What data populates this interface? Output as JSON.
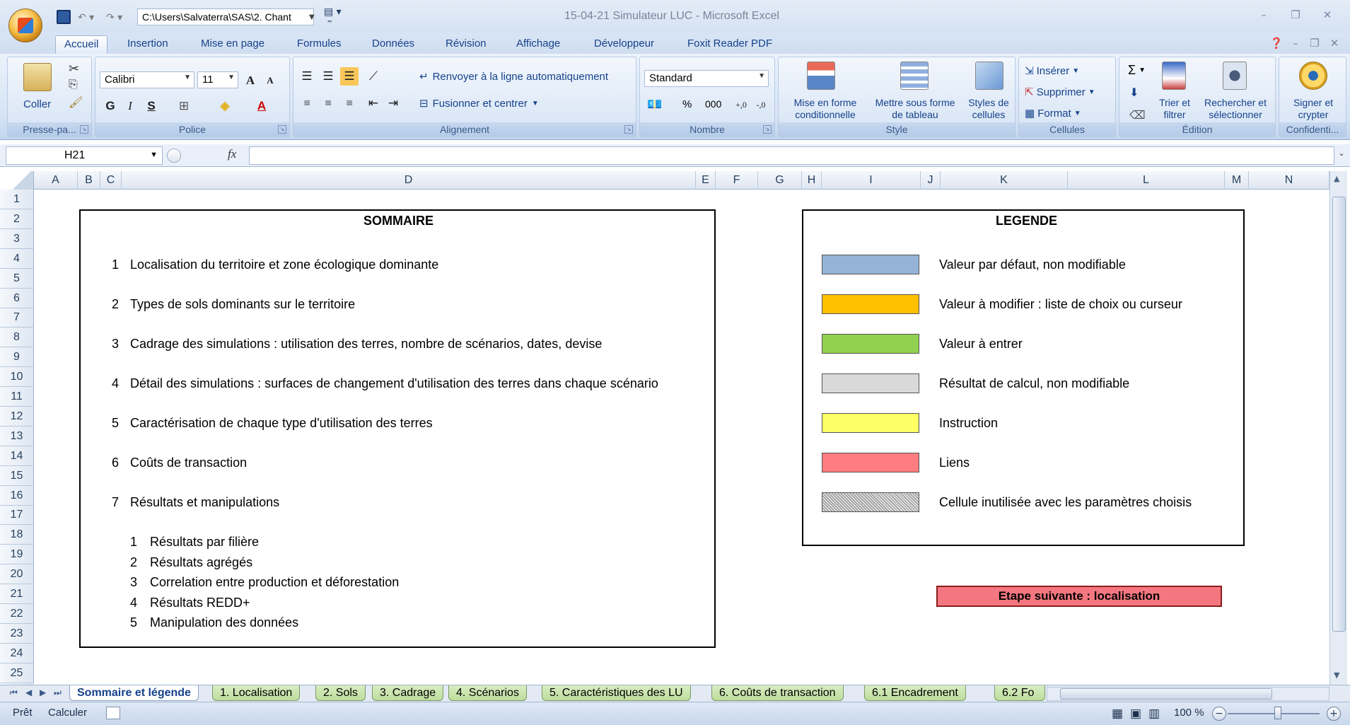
{
  "window": {
    "file_path": "C:\\Users\\Salvaterra\\SAS\\2. Chant",
    "title": "15-04-21 Simulateur LUC - Microsoft Excel"
  },
  "ribbon": {
    "tabs": [
      "Accueil",
      "Insertion",
      "Mise en page",
      "Formules",
      "Données",
      "Révision",
      "Affichage",
      "Développeur",
      "Foxit Reader PDF"
    ],
    "active_tab": "Accueil",
    "groups": {
      "clipboard": {
        "label": "Presse-pa...",
        "paste": "Coller"
      },
      "font": {
        "label": "Police",
        "font_name": "Calibri",
        "font_size": "11"
      },
      "alignment": {
        "label": "Alignement",
        "wrap": "Renvoyer à la ligne automatiquement",
        "merge": "Fusionner et centrer"
      },
      "number": {
        "label": "Nombre",
        "format": "Standard",
        "percent": "%",
        "thousands": "000"
      },
      "style": {
        "label": "Style",
        "conditional": "Mise en forme conditionnelle",
        "as_table": "Mettre sous forme de tableau",
        "cell_styles": "Styles de cellules"
      },
      "cells": {
        "label": "Cellules",
        "insert": "Insérer",
        "delete": "Supprimer",
        "format": "Format"
      },
      "editing": {
        "label": "Édition",
        "sort": "Trier et filtrer",
        "find": "Rechercher et sélectionner",
        "sigma": "Σ"
      },
      "privacy": {
        "label": "Confidenti...",
        "sign": "Signer et crypter"
      }
    }
  },
  "formula_bar": {
    "name_box": "H21",
    "fx": "fx",
    "value": ""
  },
  "columns": [
    "A",
    "B",
    "C",
    "D",
    "E",
    "F",
    "G",
    "H",
    "I",
    "J",
    "K",
    "L",
    "M",
    "N"
  ],
  "rows": [
    "1",
    "2",
    "3",
    "4",
    "5",
    "6",
    "7",
    "8",
    "9",
    "10",
    "11",
    "12",
    "13",
    "14",
    "15",
    "16",
    "17",
    "18",
    "19",
    "20",
    "21",
    "22",
    "23",
    "24",
    "25"
  ],
  "sommaire": {
    "title": "SOMMAIRE",
    "items": [
      {
        "num": "1",
        "text": "Localisation du territoire et zone écologique dominante"
      },
      {
        "num": "2",
        "text": "Types de sols dominants sur le territoire"
      },
      {
        "num": "3",
        "text": "Cadrage des simulations : utilisation des terres, nombre de scénarios, dates, devise"
      },
      {
        "num": "4",
        "text": "Détail des simulations : surfaces de changement d'utilisation des terres dans chaque scénario"
      },
      {
        "num": "5",
        "text": "Caractérisation de chaque type d'utilisation des terres"
      },
      {
        "num": "6",
        "text": "Coûts de transaction"
      },
      {
        "num": "7",
        "text": "Résultats et manipulations"
      }
    ],
    "subitems": [
      {
        "num": "1",
        "text": "Résultats par filière"
      },
      {
        "num": "2",
        "text": "Résultats agrégés"
      },
      {
        "num": "3",
        "text": "Correlation entre production et déforestation"
      },
      {
        "num": "4",
        "text": "Résultats REDD+"
      },
      {
        "num": "5",
        "text": "Manipulation des données"
      }
    ]
  },
  "legende": {
    "title": "LEGENDE",
    "items": [
      {
        "color": "#95b3d7",
        "text": "Valeur par défaut, non modifiable"
      },
      {
        "color": "#ffc000",
        "text": "Valeur à modifier : liste de choix ou curseur"
      },
      {
        "color": "#92d050",
        "text": "Valeur à entrer"
      },
      {
        "color": "#d9d9d9",
        "text": "Résultat de calcul, non modifiable"
      },
      {
        "color": "#ffff66",
        "text": "Instruction"
      },
      {
        "color": "#ff7c80",
        "text": "Liens"
      },
      {
        "color": "pattern",
        "text": "Cellule inutilisée avec les paramètres choisis"
      }
    ]
  },
  "next_button": "Etape suivante : localisation",
  "sheet_tabs": [
    "Sommaire et légende",
    "1. Localisation",
    "2. Sols",
    "3. Cadrage",
    "4. Scénarios",
    "5. Caractéristiques des LU",
    "6. Coûts de transaction",
    "6.1 Encadrement",
    "6.2 Fo"
  ],
  "active_sheet": "Sommaire et légende",
  "status": {
    "ready": "Prêt",
    "calc": "Calculer",
    "zoom": "100 %"
  }
}
